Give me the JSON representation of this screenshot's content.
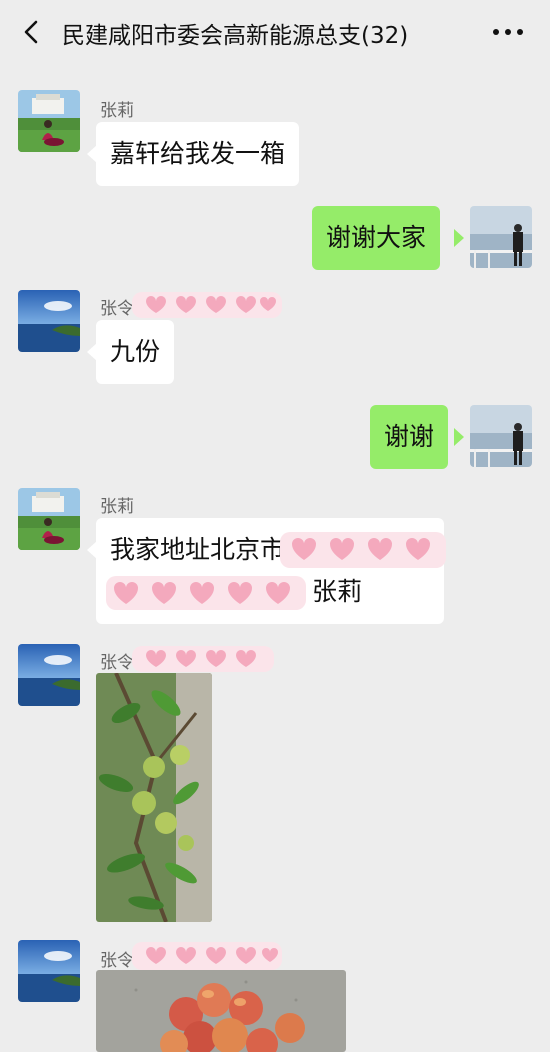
{
  "header": {
    "back_icon": "chevron-left-icon",
    "title": "民建咸阳市委会高新能源总支(32)",
    "more_icon": "ellipsis-icon"
  },
  "messages": [
    {
      "sender": "张莉",
      "text": "嘉轩给我发一箱",
      "side": "left"
    },
    {
      "text": "谢谢大家",
      "side": "right"
    },
    {
      "sender": "张令",
      "text": "九份",
      "side": "left"
    },
    {
      "text": "谢谢",
      "side": "right"
    },
    {
      "sender": "张莉",
      "text_line1": "我家地址北京市",
      "text_line2": "张莉",
      "side": "left"
    },
    {
      "sender": "张令",
      "content": "image",
      "side": "left"
    },
    {
      "sender": "张令",
      "content": "image",
      "side": "left"
    }
  ],
  "colors": {
    "background": "#ededed",
    "my_bubble": "#95ec69",
    "other_bubble": "#ffffff",
    "redaction": "#f6c2cf"
  }
}
